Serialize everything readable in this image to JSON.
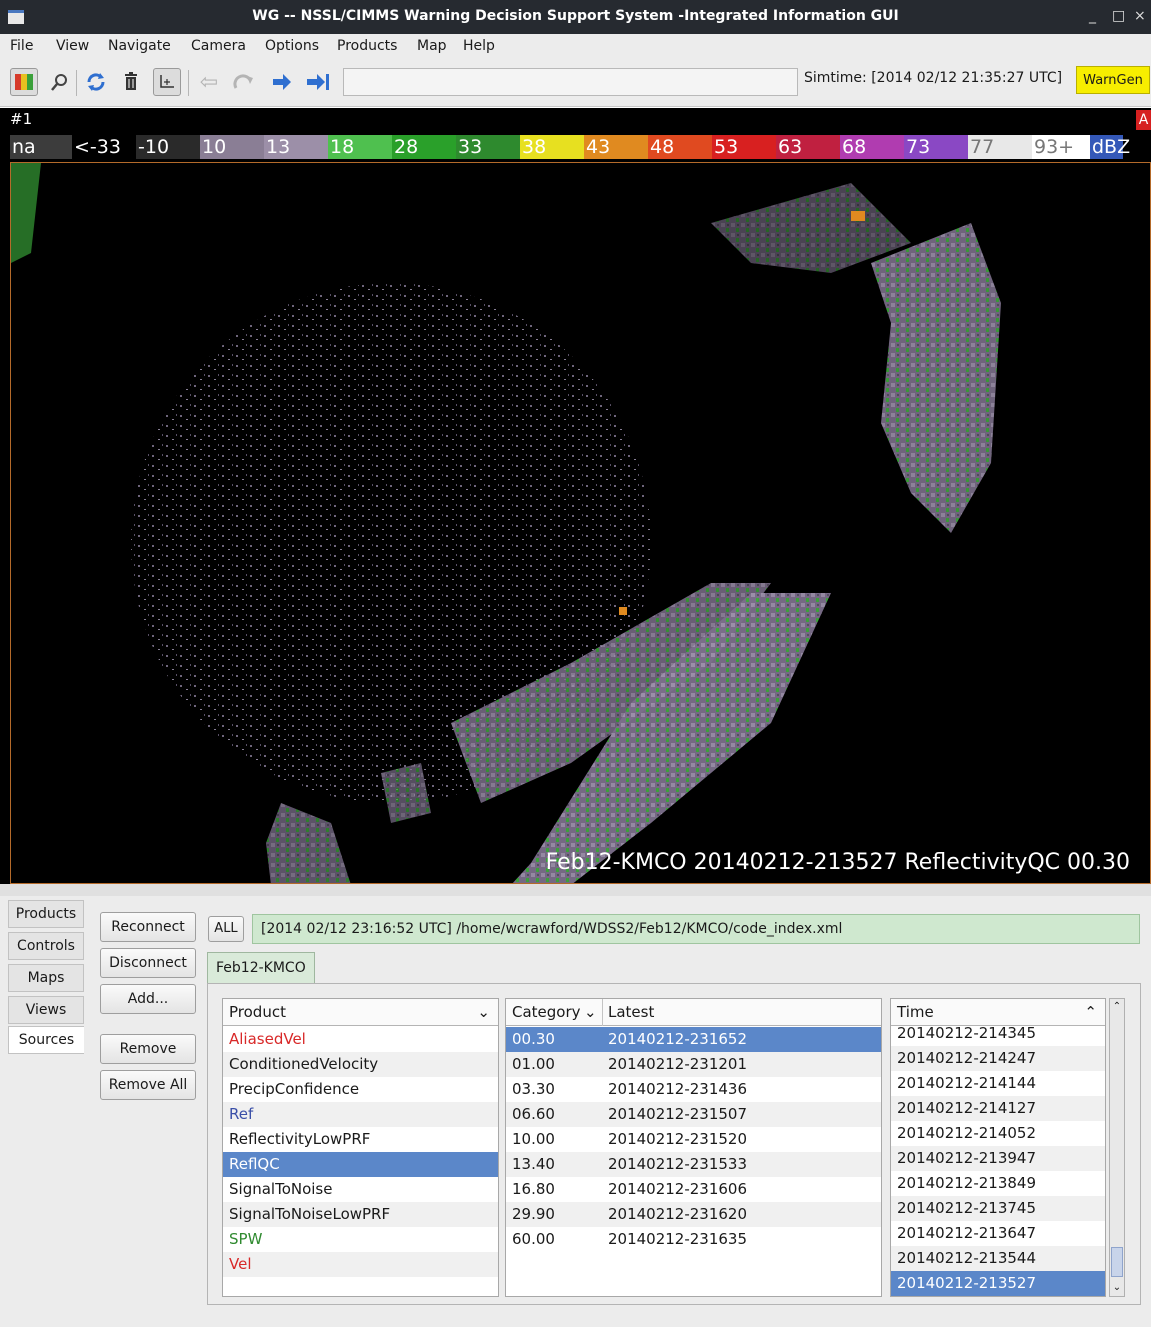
{
  "window": {
    "title": "WG -- NSSL/CIMMS Warning Decision Support System -Integrated Information GUI"
  },
  "menu": [
    "File",
    "View",
    "Navigate",
    "Camera",
    "Options",
    "Products",
    "Map",
    "Help"
  ],
  "toolbar": {
    "simtime": "Simtime: [2014 02/12 21:35:27 UTC]",
    "warngen": "WarnGen"
  },
  "display": {
    "window_label": "#1",
    "badge": "A",
    "colorbar": [
      {
        "label": "na",
        "color": "#3c3c3c"
      },
      {
        "label": "<-33",
        "color": "#000000"
      },
      {
        "label": "-10",
        "color": "#2a2a2a"
      },
      {
        "label": "10",
        "color": "#8a7e95"
      },
      {
        "label": "13",
        "color": "#9c8fa8"
      },
      {
        "label": "18",
        "color": "#4fc04f"
      },
      {
        "label": "28",
        "color": "#2aa02a"
      },
      {
        "label": "33",
        "color": "#2e8a2e"
      },
      {
        "label": "38",
        "color": "#e7e020"
      },
      {
        "label": "43",
        "color": "#e08a20"
      },
      {
        "label": "48",
        "color": "#e04a20"
      },
      {
        "label": "53",
        "color": "#d82020"
      },
      {
        "label": "63",
        "color": "#c02040"
      },
      {
        "label": "68",
        "color": "#b03cb0"
      },
      {
        "label": "73",
        "color": "#8a48c4"
      },
      {
        "label": "77",
        "color": "#e8e8e8"
      },
      {
        "label": "93+",
        "color": "#ffffff"
      },
      {
        "label": "dBZ",
        "color": "#3458b8"
      }
    ],
    "caption": "Feb12-KMCO 20140212-213527 ReflectivityQC 00.30"
  },
  "sidetabs": [
    "Products",
    "Controls",
    "Maps",
    "Views",
    "Sources"
  ],
  "buttons": {
    "reconnect": "Reconnect",
    "disconnect": "Disconnect",
    "add": "Add...",
    "remove": "Remove",
    "remove_all": "Remove All",
    "all": "ALL"
  },
  "status": "[2014 02/12 23:16:52 UTC] /home/wcrawford/WDSS2/Feb12/KMCO/code_index.xml",
  "source_tab": "Feb12-KMCO",
  "products": {
    "header": "Product",
    "items": [
      {
        "name": "AliasedVel",
        "color": "#d82828"
      },
      {
        "name": "ConditionedVelocity",
        "color": "#1a1a1a"
      },
      {
        "name": "PrecipConfidence",
        "color": "#1a1a1a"
      },
      {
        "name": "Ref",
        "color": "#3a4fa8"
      },
      {
        "name": "ReflectivityLowPRF",
        "color": "#1a1a1a"
      },
      {
        "name": "ReflQC",
        "color": "#ffffff"
      },
      {
        "name": "SignalToNoise",
        "color": "#1a1a1a"
      },
      {
        "name": "SignalToNoiseLowPRF",
        "color": "#1a1a1a"
      },
      {
        "name": "SPW",
        "color": "#2f8a2f"
      },
      {
        "name": "Vel",
        "color": "#d82828"
      }
    ],
    "selected": 5
  },
  "categories": {
    "header_category": "Category",
    "header_latest": "Latest",
    "rows": [
      [
        "00.30",
        "20140212-231652"
      ],
      [
        "01.00",
        "20140212-231201"
      ],
      [
        "03.30",
        "20140212-231436"
      ],
      [
        "06.60",
        "20140212-231507"
      ],
      [
        "10.00",
        "20140212-231520"
      ],
      [
        "13.40",
        "20140212-231533"
      ],
      [
        "16.80",
        "20140212-231606"
      ],
      [
        "29.90",
        "20140212-231620"
      ],
      [
        "60.00",
        "20140212-231635"
      ]
    ],
    "selected": 0
  },
  "times": {
    "header": "Time",
    "rows": [
      "20140212-214345",
      "20140212-214247",
      "20140212-214144",
      "20140212-214127",
      "20140212-214052",
      "20140212-213947",
      "20140212-213849",
      "20140212-213745",
      "20140212-213647",
      "20140212-213544",
      "20140212-213527"
    ],
    "selected": 10
  }
}
